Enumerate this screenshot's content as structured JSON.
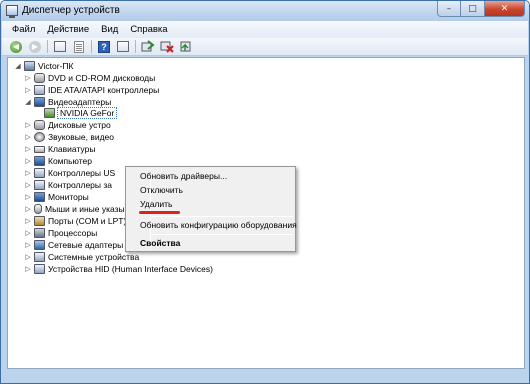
{
  "window": {
    "title": "Диспетчер устройств",
    "icon": "device-manager-icon",
    "buttons": {
      "minimize": "–",
      "maximize": "□",
      "close": "✕"
    }
  },
  "menu": [
    "Файл",
    "Действие",
    "Вид",
    "Справка"
  ],
  "toolbar": {
    "back_glyph": "◀",
    "forward_glyph": "▶",
    "icons": [
      "back-icon",
      "forward-icon",
      "properties-icon",
      "show-hide-tree-icon",
      "help-icon",
      "device-view-icon",
      "update-driver-icon",
      "uninstall-icon",
      "scan-hardware-icon"
    ]
  },
  "tree": {
    "root": "Victor-ПК",
    "expand_glyph": "▷",
    "collapse_glyph": "◢",
    "items": [
      {
        "label": "DVD и CD-ROM дисководы",
        "icon": "dvd-drive-icon",
        "expanded": false
      },
      {
        "label": "IDE ATA/ATAPI контроллеры",
        "icon": "ide-controller-icon",
        "expanded": false
      },
      {
        "label": "Видеоадаптеры",
        "icon": "display-adapter-icon",
        "expanded": true
      },
      {
        "label": "NVIDIA GeFor",
        "icon": "gpu-icon",
        "child": true,
        "selected": true
      },
      {
        "label": "Дисковые устро",
        "icon": "disk-drive-icon",
        "expanded": false
      },
      {
        "label": "Звуковые, видео",
        "icon": "sound-device-icon",
        "expanded": false
      },
      {
        "label": "Клавиатуры",
        "icon": "keyboard-icon",
        "expanded": false
      },
      {
        "label": "Компьютер",
        "icon": "computer-icon",
        "expanded": false
      },
      {
        "label": "Контроллеры US",
        "icon": "usb-controller-icon",
        "expanded": false
      },
      {
        "label": "Контроллеры за",
        "icon": "storage-controller-icon",
        "expanded": false
      },
      {
        "label": "Мониторы",
        "icon": "monitor-icon",
        "expanded": false
      },
      {
        "label": "Мыши и иные указывающие устройства",
        "icon": "mouse-icon",
        "expanded": false
      },
      {
        "label": "Порты (COM и LPT)",
        "icon": "port-icon",
        "expanded": false
      },
      {
        "label": "Процессоры",
        "icon": "processor-icon",
        "expanded": false
      },
      {
        "label": "Сетевые адаптеры",
        "icon": "network-adapter-icon",
        "expanded": false
      },
      {
        "label": "Системные устройства",
        "icon": "system-device-icon",
        "expanded": false
      },
      {
        "label": "Устройства HID (Human Interface Devices)",
        "icon": "hid-device-icon",
        "expanded": false
      }
    ]
  },
  "context_menu": {
    "items": [
      {
        "label": "Обновить драйверы...",
        "bold": false
      },
      {
        "label": "Отключить",
        "bold": false
      },
      {
        "label": "Удалить",
        "bold": false,
        "highlighted_by_underline": true
      },
      {
        "label": "Обновить конфигурацию оборудования",
        "bold": false
      },
      {
        "label": "Свойства",
        "bold": true
      }
    ],
    "underline_color": "#e0211c"
  },
  "colors": {
    "frame": "#bcd3ec",
    "selection_border": "#3c78c8",
    "close_button": "#c9462e"
  }
}
